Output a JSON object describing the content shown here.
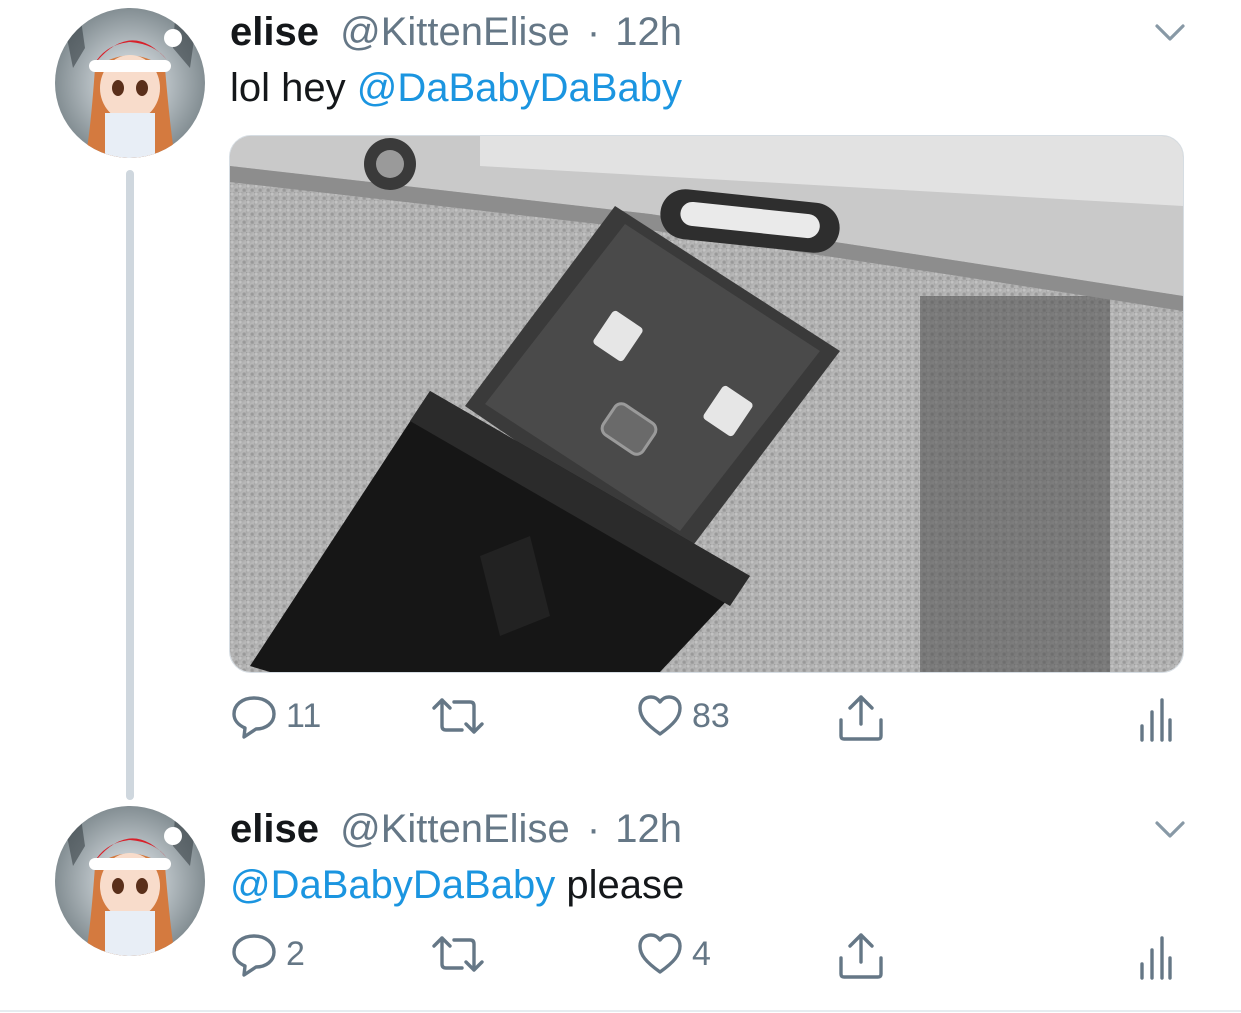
{
  "tweets": [
    {
      "name": "elise",
      "handle": "@KittenElise",
      "separator": "·",
      "time": "12h",
      "text_before": "lol hey ",
      "mention": "@DaBabyDaBaby",
      "text_after": "",
      "actions": {
        "reply_count": "11",
        "retweet_count": "",
        "like_count": "83"
      }
    },
    {
      "name": "elise",
      "handle": "@KittenElise",
      "separator": "·",
      "time": "12h",
      "text_before": "",
      "mention": "@DaBabyDaBaby",
      "text_after": " please",
      "actions": {
        "reply_count": "2",
        "retweet_count": "",
        "like_count": "4"
      }
    }
  ],
  "colors": {
    "mention": "#1b95e0",
    "secondary_text": "#657786",
    "thread_line": "#cfd7de"
  },
  "icons": [
    "chevron-down-icon",
    "reply-icon",
    "retweet-icon",
    "like-icon",
    "share-icon",
    "analytics-icon"
  ]
}
